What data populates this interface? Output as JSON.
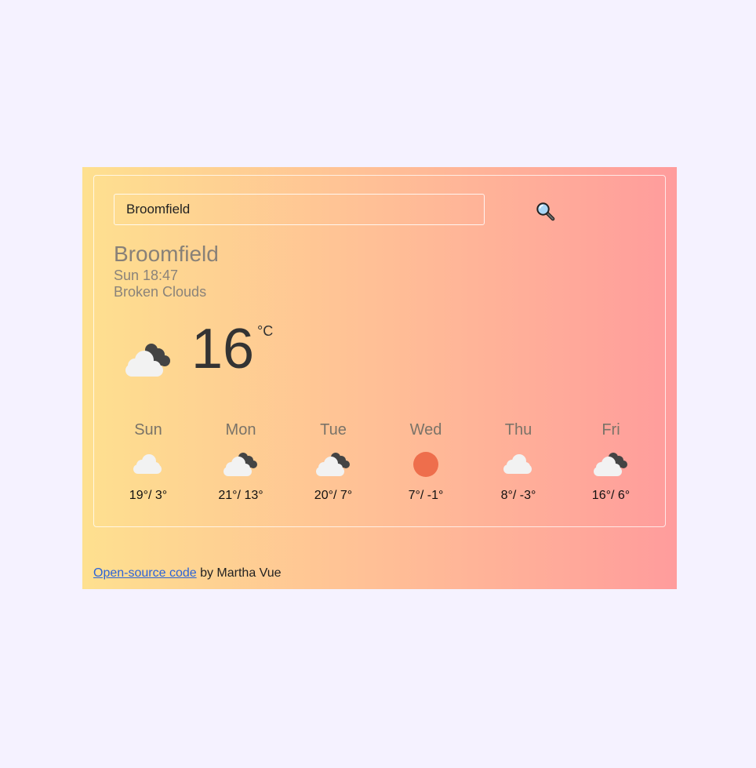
{
  "search": {
    "value": "Broomfield",
    "icon": "magnifying-glass-icon"
  },
  "current": {
    "city": "Broomfield",
    "datetime": "Sun 18:47",
    "description": "Broken Clouds",
    "temperature": "16",
    "unit": "°C",
    "icon": "broken-clouds-icon"
  },
  "forecast": [
    {
      "day": "Sun",
      "temps": "19°/ 3°",
      "icon": "cloud-icon"
    },
    {
      "day": "Mon",
      "temps": "21°/ 13°",
      "icon": "broken-clouds-icon"
    },
    {
      "day": "Tue",
      "temps": "20°/ 7°",
      "icon": "broken-clouds-icon"
    },
    {
      "day": "Wed",
      "temps": "7°/ -1°",
      "icon": "sun-icon"
    },
    {
      "day": "Thu",
      "temps": "8°/ -3°",
      "icon": "cloud-icon"
    },
    {
      "day": "Fri",
      "temps": "16°/ 6°",
      "icon": "broken-clouds-icon"
    }
  ],
  "footer": {
    "link_text": "Open-source code",
    "credit": " by Martha Vue"
  },
  "colors": {
    "gradient_start": "#fee08f",
    "gradient_end": "#ff9c9c",
    "sun": "#ee6e4c",
    "dark_cloud": "#444444",
    "light_cloud": "#f2f2f2"
  }
}
